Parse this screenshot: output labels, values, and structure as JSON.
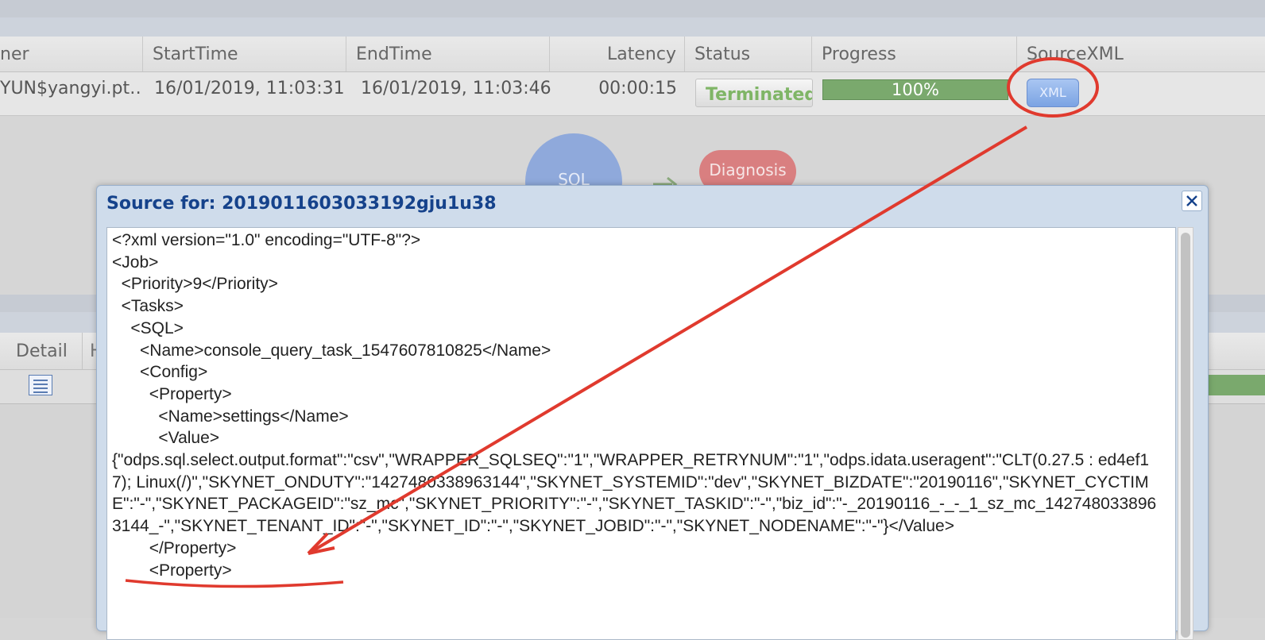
{
  "grid": {
    "columns": {
      "owner": "ner",
      "start_time": "StartTime",
      "end_time": "EndTime",
      "latency": "Latency",
      "status": "Status",
      "progress": "Progress",
      "source_xml": "SourceXML"
    },
    "row": {
      "owner": "YUN$yangyi.pt…",
      "start_time": "16/01/2019, 11:03:31",
      "end_time": "16/01/2019, 11:03:46",
      "latency": "00:00:15",
      "status": "Terminated",
      "progress_label": "100%",
      "progress_value": 1.0,
      "xml_button": "XML"
    }
  },
  "diagram": {
    "sql_node": "SQL",
    "diagnosis_node": "Diagnosis"
  },
  "lower_panel": {
    "tab_detail": "Detail",
    "tab_h": "H"
  },
  "dialog": {
    "title": "Source for: 2019011603033192gju1u38",
    "source_text": "<?xml version=\"1.0\" encoding=\"UTF-8\"?>\n<Job>\n  <Priority>9</Priority>\n  <Tasks>\n    <SQL>\n      <Name>console_query_task_1547607810825</Name>\n      <Config>\n        <Property>\n          <Name>settings</Name>\n          <Value>\n{\"odps.sql.select.output.format\":\"csv\",\"WRAPPER_SQLSEQ\":\"1\",\"WRAPPER_RETRYNUM\":\"1\",\"odps.idata.useragent\":\"CLT(0.27.5 : ed4ef17); Linux(/)\",\"SKYNET_ONDUTY\":\"1427480338963144\",\"SKYNET_SYSTEMID\":\"dev\",\"SKYNET_BIZDATE\":\"20190116\",\"SKYNET_CYCTIME\":\"-\",\"SKYNET_PACKAGEID\":\"sz_mc\",\"SKYNET_PRIORITY\":\"-\",\"SKYNET_TASKID\":\"-\",\"biz_id\":\"-_20190116_-_-_1_sz_mc_1427480338963144_-\",\"SKYNET_TENANT_ID\":\"-\",\"SKYNET_ID\":\"-\",\"SKYNET_JOBID\":\"-\",\"SKYNET_NODENAME\":\"-\"}</Value>\n        </Property>\n        <Property>"
  },
  "colors": {
    "annotation_red": "#e03a2e",
    "title_blue": "#15428b",
    "progress_green": "#7aa96d",
    "status_green": "#7fb566"
  },
  "icons": {
    "close": "close-icon",
    "list": "list-icon"
  }
}
